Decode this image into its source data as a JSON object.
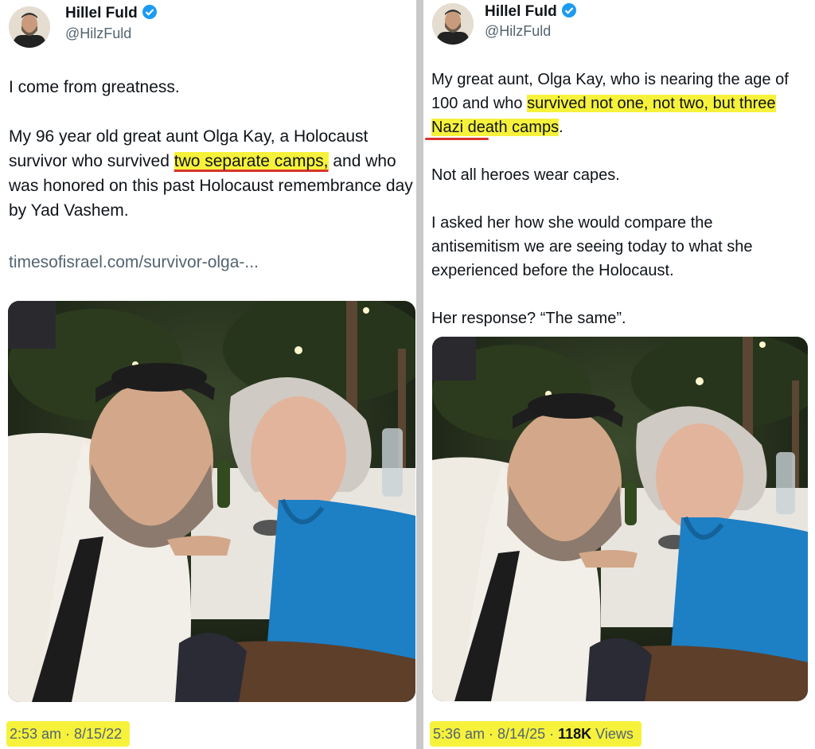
{
  "left_tweet": {
    "author": {
      "name": "Hillel Fuld",
      "handle": "@HilzFuld"
    },
    "text": {
      "line1": "I come from greatness.",
      "p2_before": "My 96 year old great aunt Olga Kay, a Holocaust survivor who survived ",
      "p2_highlight": "two separate camps,",
      "p2_after": " and who was honored on this past Holocaust remembrance day by Yad Vashem."
    },
    "link": "timesofisrael.com/survivor-olga-...",
    "timestamp": "2:53 am · 8/15/22"
  },
  "right_tweet": {
    "author": {
      "name": "Hillel Fuld",
      "handle": "@HilzFuld"
    },
    "text": {
      "p1_before": "My great aunt, Olga Kay, who is nearing the age of 100 and who ",
      "p1_highlight": "survived not one, not two, but three Nazi death camps",
      "p1_after": ".",
      "p2": "Not all heroes wear capes.",
      "p3": "I asked her how she would compare the antisemitism we are seeing today to what she experienced before the Holocaust.",
      "p4": "Her response? “The same”."
    },
    "time": "5:36 am · 8/14/25 · ",
    "views_count": "118K",
    "views_label": " Views"
  },
  "colors": {
    "highlight": "#f6f23b",
    "underline": "#d8342c",
    "verified_badge": "#1d9bf0",
    "secondary_text": "#536471",
    "blouse": "#1d7fc4",
    "shirt": "#f2eee8"
  },
  "icons": [
    "verified-badge-icon"
  ]
}
